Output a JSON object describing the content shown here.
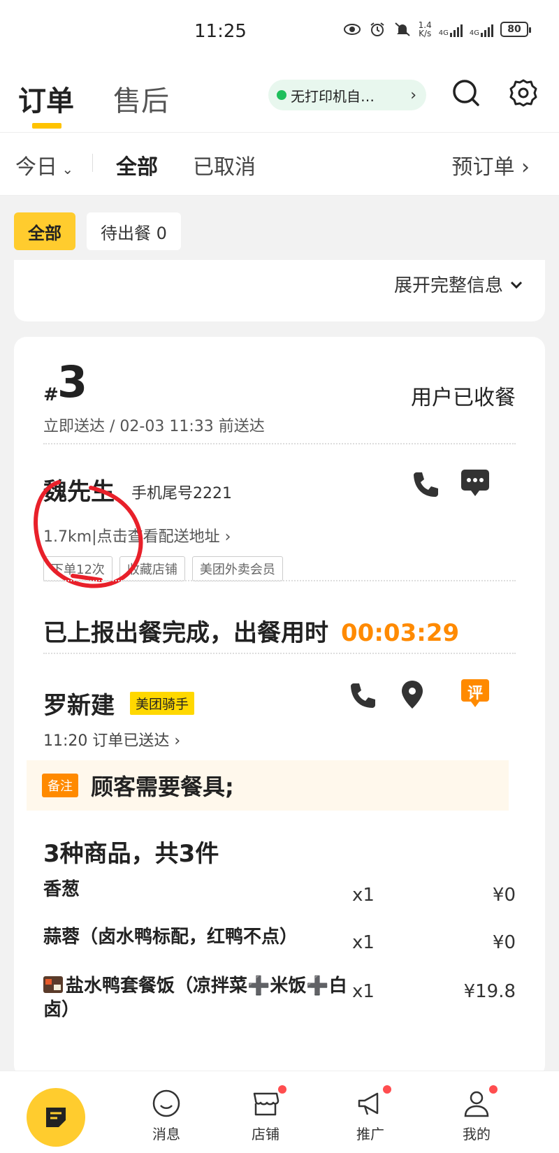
{
  "status_bar": {
    "time": "11:25",
    "net_speed_value": "1.4",
    "net_speed_unit": "K/s",
    "sim1": "4G",
    "sim2": "4G",
    "battery": "80"
  },
  "header": {
    "tab_active": "订单",
    "tab_inactive": "售后",
    "printer_status": "无打印机自…"
  },
  "filter": {
    "date": "今日",
    "all": "全部",
    "cancelled": "已取消",
    "preorder": "预订单"
  },
  "chips": {
    "all": "全部",
    "pending": "待出餐 0"
  },
  "prev_card": {
    "expand": "展开完整信息"
  },
  "order": {
    "hash": "#",
    "number": "3",
    "status": "用户已收餐",
    "delivery": "立即送达 / 02-03 11:33 前送达",
    "customer": {
      "name": "魏先生",
      "phone": "手机尾号2221",
      "address": "1.7km|点击查看配送地址",
      "tags": [
        "下单12次",
        "收藏店铺",
        "美团外卖会员"
      ]
    },
    "meal": {
      "text": "已上报出餐完成，出餐用时",
      "time": "00:03:29"
    },
    "rider": {
      "name": "罗新建",
      "badge": "美团骑手",
      "status": "11:20  订单已送达"
    },
    "remark": {
      "tag": "备注",
      "text": "顾客需要餐具;"
    },
    "goods": {
      "title": "3种商品，共3件",
      "items": [
        {
          "name": "香葱",
          "qty": "x1",
          "price": "¥0"
        },
        {
          "name": "蒜蓉（卤水鸭标配，红鸭不点）",
          "qty": "x1",
          "price": "¥0"
        },
        {
          "name": "盐水鸭套餐饭（凉拌菜➕米饭➕白卤）",
          "qty": "x1",
          "price": "¥19.8"
        }
      ]
    },
    "rate_icon": "评"
  },
  "nav": {
    "items": [
      "消息",
      "店铺",
      "推广",
      "我的"
    ]
  },
  "colors": {
    "brand_yellow": "#ffcc2e",
    "accent_orange": "#ff8a00",
    "green": "#1fbf5c",
    "red_mark": "#e8202a"
  }
}
